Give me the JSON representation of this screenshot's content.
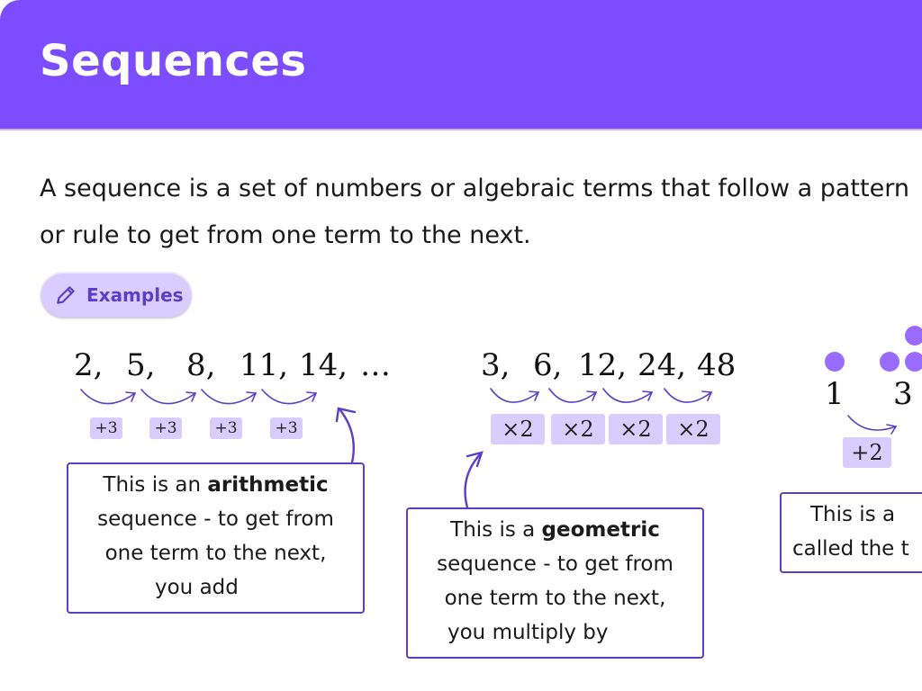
{
  "header": {
    "title": "Sequences",
    "background": "#7c4dff"
  },
  "intro": {
    "line1": "A sequence is a set of numbers or algebraic terms that follow a pattern",
    "line2": "or rule to get from one term to the next."
  },
  "examples_chip": {
    "label": "Examples",
    "icon": "pencil-icon"
  },
  "arithmetic": {
    "terms": [
      "2,",
      "5,",
      "8,",
      "11,",
      "14,",
      "…"
    ],
    "steps": [
      "+3",
      "+3",
      "+3",
      "+3"
    ],
    "note": {
      "pre": "This is an ",
      "bold": "arithmetic",
      "post1": "sequence - to get from",
      "post2": "one term to the next,",
      "post3": "you add"
    }
  },
  "geometric": {
    "terms": [
      "3,",
      "6,",
      "12,",
      "24,",
      "48"
    ],
    "steps": [
      "×2",
      "×2",
      "×2",
      "×2"
    ],
    "note": {
      "pre": "This is a ",
      "bold": "geometric",
      "post1": "sequence - to get from",
      "post2": "one term to the next,",
      "post3": "you multiply by"
    }
  },
  "triangular": {
    "terms": [
      "1",
      "3"
    ],
    "steps": [
      "+2"
    ],
    "note": {
      "line1": "This is a",
      "line2": "called the t"
    }
  },
  "colors": {
    "accent": "#7c4dff",
    "badge": "#d9ccff",
    "arrow": "#5b3fc4",
    "dot": "#9a6bff"
  }
}
